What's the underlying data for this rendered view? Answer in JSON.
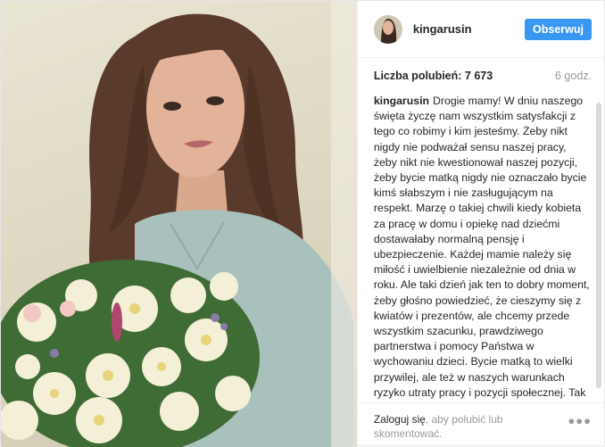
{
  "post": {
    "username": "kingarusin",
    "follow_label": "Obserwuj",
    "likes_label": "Liczba polubień: 7 673",
    "time_ago": "6 godz.",
    "caption_author": "kingarusin",
    "caption_text": "Drogie mamy! W dniu naszego święta życzę nam wszystkim satysfakcji z tego co robimy i kim jesteśmy. Żeby nikt nigdy nie podważał sensu naszej pracy, żeby nikt nie kwestionował naszej pozycji, żeby bycie matką nigdy nie oznaczało bycie kimś słabszym i nie zasługującym na respekt. Marzę o takiej chwili kiedy kobieta za pracę w domu i opiekę nad dziećmi dostawałaby normalną pensję i ubezpieczenie. Każdej mamie należy się miłość i uwielbienie niezależnie od dnia w roku. Ale taki dzień jak ten to dobry moment, żeby głośno powiedzieć, że cieszymy się z kwiatów i prezentów, ale chcemy przede wszystkim szacunku, prawdziwego partnerstwa i pomocy Państwa w wychowaniu dzieci. Bycie matką to wielki przywilej, ale też w naszych warunkach ryzyko utraty pracy i pozycji społecznej. Tak nie powinno być. I"
  },
  "footer": {
    "login_link": "Zaloguj się",
    "login_rest": ", aby polubić lub skomentować."
  },
  "icons": {
    "more": "more-options-icon"
  }
}
